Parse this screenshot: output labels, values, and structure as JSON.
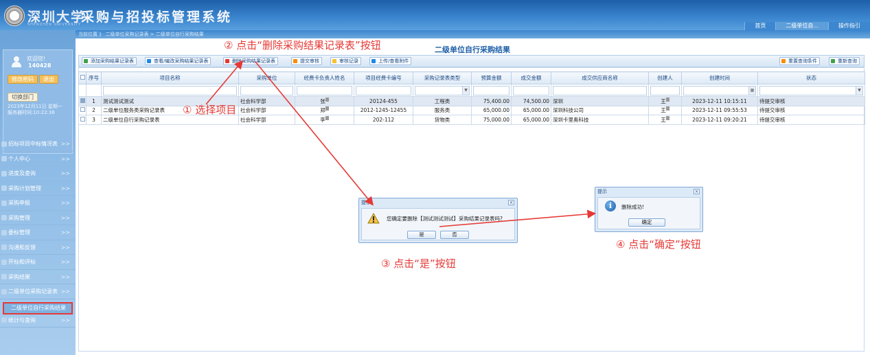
{
  "header": {
    "logo_text": "深圳大学",
    "logo_sub": "SHENZHEN UNIVERSITY",
    "system_title": "采购与招投标管理系统",
    "tabs": [
      "首页",
      "二级单位自...",
      "操作指引"
    ]
  },
  "breadcrumb": "当前位置 》 二级单位采购记录表 > 二级单位自行采购结果",
  "sidebar": {
    "welcome": "欢迎您!",
    "user_id": "140428",
    "change_password": "修改密码",
    "logout": "退出",
    "switch_dept": "切换部门",
    "date_line1": "2023年12月11日 星期一",
    "date_line2": "服务器时间:10:22:36",
    "menu": [
      {
        "label": "招标项目中标情况表",
        "arrow": ">>"
      },
      {
        "label": "个人中心",
        "arrow": ">>"
      },
      {
        "label": "进度及查询",
        "arrow": ">>"
      },
      {
        "label": "采购计划管理",
        "arrow": ">>"
      },
      {
        "label": "采购申报",
        "arrow": ">>"
      },
      {
        "label": "采购管理",
        "arrow": ">>"
      },
      {
        "label": "委标管理",
        "arrow": ">>"
      },
      {
        "label": "沟通和反馈",
        "arrow": ">>"
      },
      {
        "label": "开标和评标",
        "arrow": ">>"
      },
      {
        "label": "采购结果",
        "arrow": ">>"
      },
      {
        "label": "二级单位采购记录表",
        "arrow": ">>"
      },
      {
        "label": "统计与查询",
        "arrow": ">>"
      }
    ],
    "active_sub": "二级单位自行采购结果"
  },
  "main": {
    "title": "二级单位自行采购结果",
    "toolbar": {
      "add": "添加采购结果记录表",
      "view_edit": "查看/编改采购结果记录表",
      "delete": "删除采购结果记录表",
      "submit": "提交审核",
      "audit_log": "审核记录",
      "upload": "上传/查看附件",
      "reset": "重置查询条件",
      "requery": "重新查询"
    },
    "columns": [
      "序号",
      "项目名称",
      "采购单位",
      "经费卡负责人姓名",
      "项目经费卡编号",
      "采购记录表类型",
      "预算金额",
      "成交金额",
      "成交供应商名称",
      "创建人",
      "创建时间",
      "状态"
    ],
    "rows": [
      {
        "no": "1",
        "name": "测试测试测试",
        "unit": "社会科学部",
        "owner": "张",
        "card": "20124-455",
        "type": "工程类",
        "budget": "75,400.00",
        "deal": "74,500.00",
        "supplier": "深圳",
        "creator": "王",
        "created": "2023-12-11 10:15:11",
        "status": "待提交审核",
        "selected": true
      },
      {
        "no": "2",
        "name": "二级单位服务类采购记录表",
        "unit": "社会科学部",
        "owner": "郑",
        "card": "2012-1245-12455",
        "type": "服务类",
        "budget": "65,000.00",
        "deal": "65,000.00",
        "supplier": "深圳科技公司",
        "creator": "王",
        "created": "2023-12-11 09:55:53",
        "status": "待提交审核",
        "selected": false
      },
      {
        "no": "3",
        "name": "二级单位自行采购记录表",
        "unit": "社会科学部",
        "owner": "李",
        "card": "202-112",
        "type": "货物类",
        "budget": "75,000.00",
        "deal": "65,000.00",
        "supplier": "深圳卡里奥科技",
        "creator": "王",
        "created": "2023-12-11 09:20:21",
        "status": "待提交审核",
        "selected": false
      }
    ]
  },
  "confirm_dialog": {
    "title": "提示",
    "message": "您确定要删除【测试测试测试】采购结果记录表吗?",
    "yes": "是",
    "no": "否"
  },
  "success_dialog": {
    "title": "提示",
    "message": "删除成功!",
    "ok": "确定"
  },
  "annotations": {
    "step1": "① 选择项目",
    "step2": "② 点击“删除采购结果记录表”按钮",
    "step3": "③ 点击“是”按钮",
    "step4": "④ 点击“确定”按钮"
  },
  "colors": {
    "header_blue": "#1d5fa8",
    "annotation_red": "#e53935",
    "sidebar_blue": "#8dbbe6"
  }
}
